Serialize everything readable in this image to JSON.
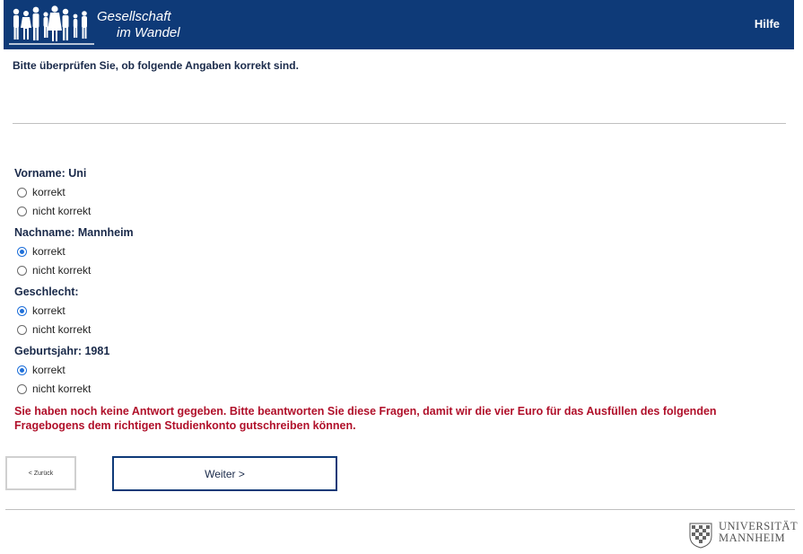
{
  "header": {
    "logo_line1": "Gesellschaft",
    "logo_line2": "im Wandel",
    "help_label": "Hilfe",
    "background_color": "#0e3a78"
  },
  "intro": "Bitte überprüfen Sie, ob folgende Angaben korrekt sind.",
  "questions": [
    {
      "label": "Vorname: Uni",
      "options": [
        {
          "label": "korrekt",
          "selected": false
        },
        {
          "label": "nicht korrekt",
          "selected": false
        }
      ]
    },
    {
      "label": "Nachname: Mannheim",
      "options": [
        {
          "label": "korrekt",
          "selected": true
        },
        {
          "label": "nicht korrekt",
          "selected": false
        }
      ]
    },
    {
      "label": "Geschlecht:",
      "options": [
        {
          "label": "korrekt",
          "selected": true
        },
        {
          "label": "nicht korrekt",
          "selected": false
        }
      ]
    },
    {
      "label": "Geburtsjahr: 1981",
      "options": [
        {
          "label": "korrekt",
          "selected": true
        },
        {
          "label": "nicht korrekt",
          "selected": false
        }
      ]
    }
  ],
  "error_message": "Sie haben noch keine Antwort gegeben. Bitte beantworten Sie diese Fragen, damit wir die vier Euro für das Ausfüllen des folgenden Fragebogens dem richtigen Studienkonto gutschreiben können.",
  "buttons": {
    "back_label": "< Zurück",
    "next_label": "Weiter >"
  },
  "footer": {
    "logo_line1": "UNIVERSITÄT",
    "logo_line2": "MANNHEIM"
  },
  "colors": {
    "brand": "#0e3a78",
    "error": "#b0102a",
    "radio_selected": "#1e6fd9"
  }
}
